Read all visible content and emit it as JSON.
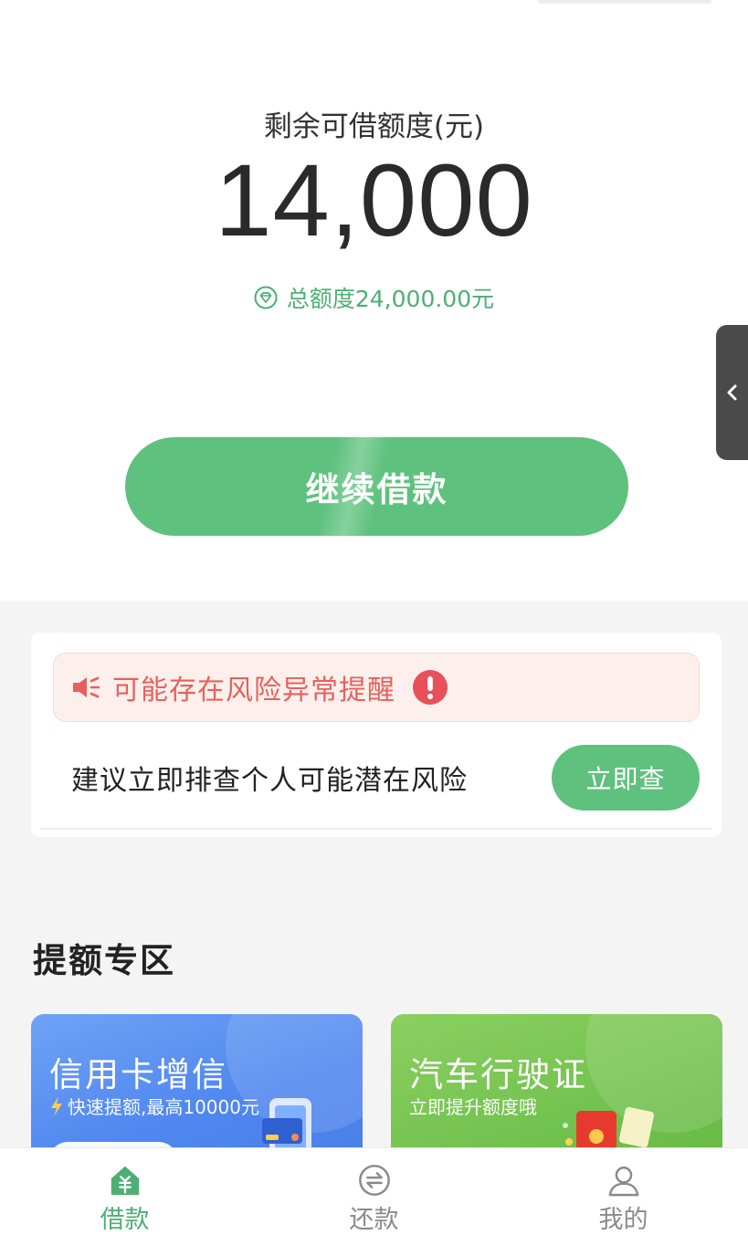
{
  "credit": {
    "label": "剩余可借额度(元)",
    "amount": "14,000",
    "total": "总额度24,000.00元"
  },
  "actions": {
    "continue_label": "继续借款"
  },
  "risk": {
    "alert_text": "可能存在风险异常提醒",
    "description": "建议立即排查个人可能潜在风险",
    "check_label": "立即查"
  },
  "boost": {
    "section_title": "提额专区",
    "cards": [
      {
        "title": "信用卡增信",
        "subtitle": "快速提额,最高10000元"
      },
      {
        "title": "汽车行驶证",
        "subtitle": "立即提升额度哦"
      }
    ]
  },
  "tabbar": {
    "items": [
      {
        "label": "借款",
        "icon": "home-yuan-icon",
        "active": true
      },
      {
        "label": "还款",
        "icon": "repay-exchange-icon",
        "active": false
      },
      {
        "label": "我的",
        "icon": "user-icon",
        "active": false
      }
    ]
  },
  "colors": {
    "accent": "#5ec17d",
    "accent_text": "#4daf74",
    "alert": "#e8605c",
    "alert_bg": "#fdf0ec",
    "card_blue": "#4f86ef",
    "card_green": "#6fc04c"
  }
}
